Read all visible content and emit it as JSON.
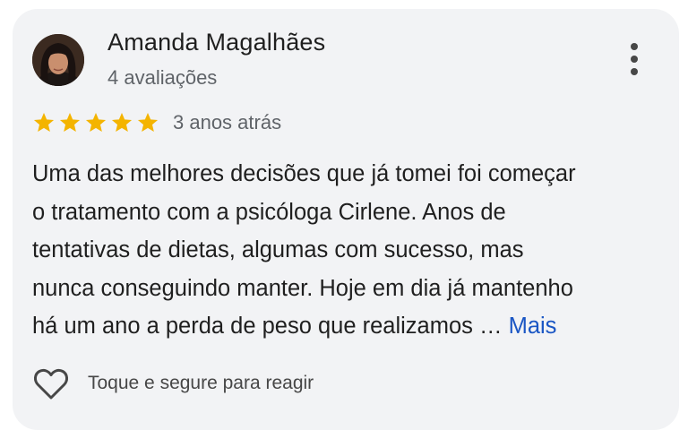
{
  "review": {
    "author": {
      "name": "Amanda Magalhães",
      "review_count": "4 avaliações",
      "avatar_icon": "profile-photo"
    },
    "menu_icon": "more-vert-icon",
    "rating": {
      "stars": 5,
      "max_stars": 5,
      "star_color": "#f4b400"
    },
    "date": "3 anos atrás",
    "text_lines": [
      "Uma das melhores decisões que já tomei foi começar",
      "o tratamento com a psicóloga Cirlene. Anos de",
      "tentativas de dietas, algumas com sucesso, mas",
      "nunca conseguindo manter. Hoje em dia já mantenho",
      "há um ano a perda de peso que realizamos …"
    ],
    "more_label": "Mais",
    "more_color": "#1a56c4",
    "react": {
      "icon": "heart-outline-icon",
      "label": "Toque e segure para reagir"
    }
  },
  "colors": {
    "card_background": "#f2f3f5",
    "text_primary": "#1f1f1f",
    "text_secondary": "#5f6368"
  }
}
